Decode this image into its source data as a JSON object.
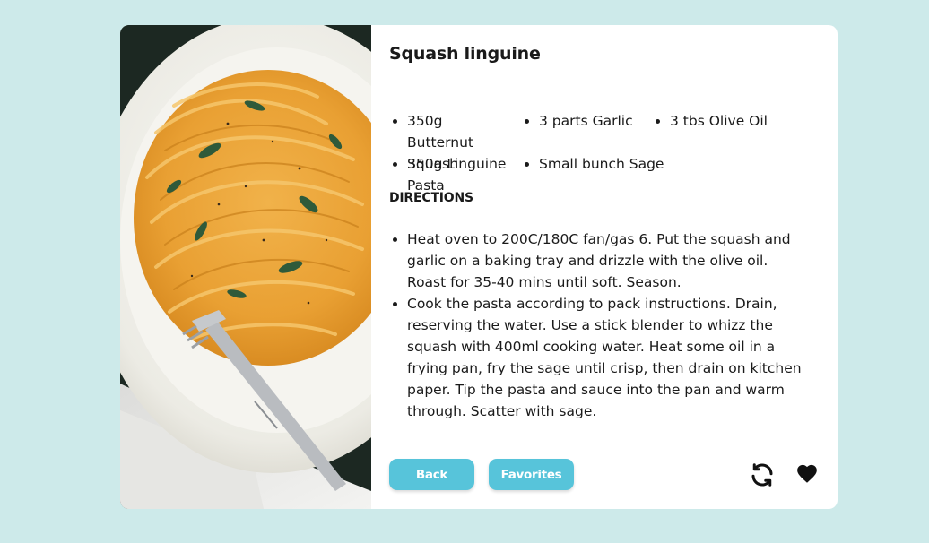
{
  "recipe": {
    "title": "Squash linguine",
    "ingredients": [
      "350g Butternut Squash",
      "3 parts Garlic",
      "3 tbs Olive Oil",
      "350g Linguine Pasta",
      "Small bunch Sage"
    ],
    "directions_heading": "DIRECTIONS",
    "directions": [
      "Heat oven to 200C/180C fan/gas 6. Put the squash and garlic on a baking tray and drizzle with the olive oil. Roast for 35-40 mins until soft. Season.",
      "Cook the pasta according to pack instructions. Drain, reserving the water. Use a stick blender to whizz the squash with 400ml cooking water. Heat some oil in a frying pan, fry the sage until crisp, then drain on kitchen paper. Tip the pasta and sauce into the pan and warm through. Scatter with sage."
    ]
  },
  "actions": {
    "back_label": "Back",
    "favorites_label": "Favorites",
    "refresh_icon": "refresh-icon",
    "heart_icon": "heart-icon"
  },
  "colors": {
    "background": "#cdeaea",
    "card": "#ffffff",
    "button": "#57c4da",
    "text": "#1a1a1a"
  }
}
